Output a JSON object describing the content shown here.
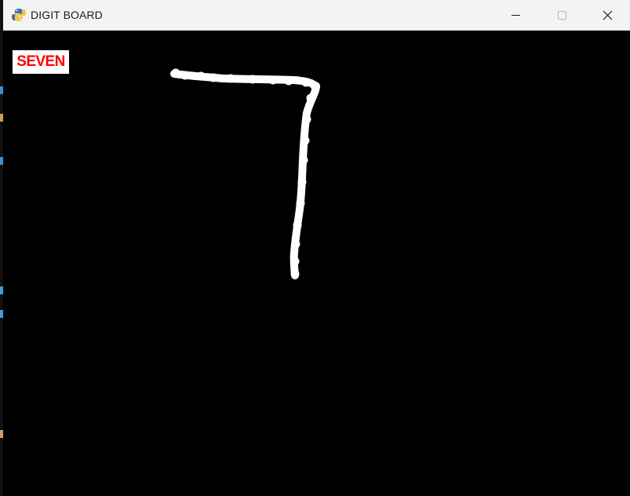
{
  "window": {
    "title": "DIGIT BOARD",
    "app_icon": "pygame-snake-icon",
    "controls": {
      "minimize_icon": "minimize-icon",
      "maximize_icon": "maximize-icon",
      "close_icon": "close-icon"
    }
  },
  "board": {
    "prediction_label": "SEVEN",
    "prediction_color": "#ff0000",
    "prediction_background": "#ffffff",
    "background_color": "#000000",
    "stroke_color": "#ffffff"
  }
}
